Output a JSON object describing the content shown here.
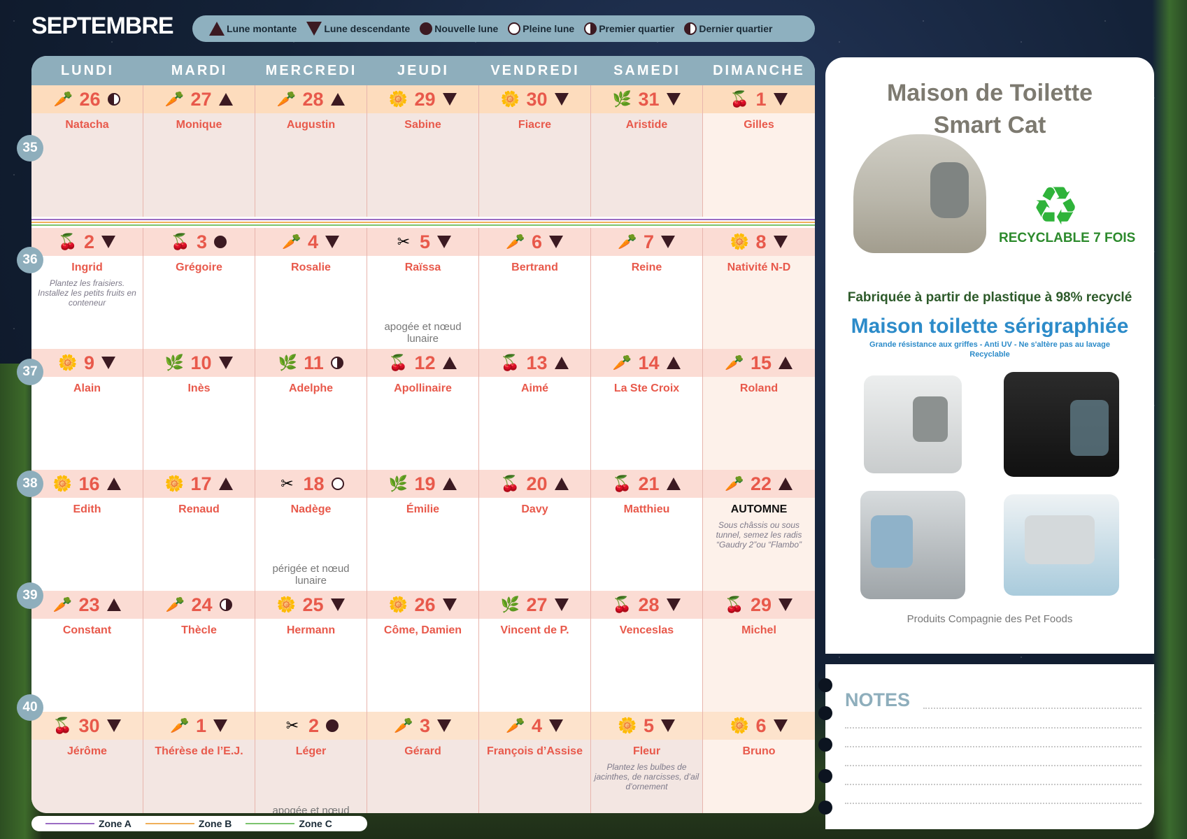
{
  "month": "SEPTEMBRE",
  "legend": {
    "rising": "Lune montante",
    "falling": "Lune descendante",
    "new_moon": "Nouvelle lune",
    "full_moon": "Pleine lune",
    "first_quarter": "Premier quartier",
    "last_quarter": "Dernier quartier"
  },
  "days": [
    "LUNDI",
    "MARDI",
    "MERCREDI",
    "JEUDI",
    "VENDREDI",
    "SAMEDI",
    "DIMANCHE"
  ],
  "weeks": [
    {
      "num": "35",
      "cells": [
        {
          "day": "26",
          "saint": "Natacha",
          "moon": "last",
          "plant": "carrot-icon",
          "glyph": "🥕"
        },
        {
          "day": "27",
          "saint": "Monique",
          "moon": "up",
          "plant": "carrot-icon",
          "glyph": "🥕"
        },
        {
          "day": "28",
          "saint": "Augustin",
          "moon": "up",
          "plant": "carrot-icon",
          "glyph": "🥕"
        },
        {
          "day": "29",
          "saint": "Sabine",
          "moon": "down",
          "plant": "flower-icon",
          "glyph": "🌼"
        },
        {
          "day": "30",
          "saint": "Fiacre",
          "moon": "down",
          "plant": "flower-icon",
          "glyph": "🌼"
        },
        {
          "day": "31",
          "saint": "Aristide",
          "moon": "down",
          "plant": "leaf-icon",
          "glyph": "🌿"
        },
        {
          "day": "1",
          "saint": "Gilles",
          "moon": "down",
          "plant": "cherry-icon",
          "glyph": "🍒"
        }
      ]
    },
    {
      "num": "36",
      "cells": [
        {
          "day": "2",
          "saint": "Ingrid",
          "moon": "down",
          "plant": "cherry-icon",
          "glyph": "🍒",
          "note": "Plantez les fraisiers. Installez les petits fruits en conteneur"
        },
        {
          "day": "3",
          "saint": "Grégoire",
          "moon": "new",
          "plant": "cherry-icon",
          "glyph": "🍒"
        },
        {
          "day": "4",
          "saint": "Rosalie",
          "moon": "down",
          "plant": "carrot-icon",
          "glyph": "🥕"
        },
        {
          "day": "5",
          "saint": "Raïssa",
          "moon": "down",
          "plant": "tools-icon",
          "glyph": "✂",
          "astro": "apogée et nœud lunaire"
        },
        {
          "day": "6",
          "saint": "Bertrand",
          "moon": "down",
          "plant": "carrot-icon",
          "glyph": "🥕"
        },
        {
          "day": "7",
          "saint": "Reine",
          "moon": "down",
          "plant": "carrot-icon",
          "glyph": "🥕"
        },
        {
          "day": "8",
          "saint": "Nativité N-D",
          "moon": "down",
          "plant": "flower-icon",
          "glyph": "🌼"
        }
      ]
    },
    {
      "num": "37",
      "cells": [
        {
          "day": "9",
          "saint": "Alain",
          "moon": "down",
          "plant": "flower-icon",
          "glyph": "🌼"
        },
        {
          "day": "10",
          "saint": "Inès",
          "moon": "down",
          "plant": "leaf-icon",
          "glyph": "🌿"
        },
        {
          "day": "11",
          "saint": "Adelphe",
          "moon": "first",
          "plant": "leaf-icon",
          "glyph": "🌿"
        },
        {
          "day": "12",
          "saint": "Apollinaire",
          "moon": "up",
          "plant": "cherry-icon",
          "glyph": "🍒"
        },
        {
          "day": "13",
          "saint": "Aimé",
          "moon": "up",
          "plant": "cherry-icon",
          "glyph": "🍒"
        },
        {
          "day": "14",
          "saint": "La Ste Croix",
          "moon": "up",
          "plant": "carrot-icon",
          "glyph": "🥕"
        },
        {
          "day": "15",
          "saint": "Roland",
          "moon": "up",
          "plant": "carrot-icon",
          "glyph": "🥕"
        }
      ]
    },
    {
      "num": "38",
      "cells": [
        {
          "day": "16",
          "saint": "Edith",
          "moon": "up",
          "plant": "flower-icon",
          "glyph": "🌼"
        },
        {
          "day": "17",
          "saint": "Renaud",
          "moon": "up",
          "plant": "flower-icon",
          "glyph": "🌼"
        },
        {
          "day": "18",
          "saint": "Nadège",
          "moon": "full",
          "plant": "tools-icon",
          "glyph": "✂",
          "astro": "périgée et nœud lunaire"
        },
        {
          "day": "19",
          "saint": "Émilie",
          "moon": "up",
          "plant": "leaf-icon",
          "glyph": "🌿"
        },
        {
          "day": "20",
          "saint": "Davy",
          "moon": "up",
          "plant": "cherry-icon",
          "glyph": "🍒"
        },
        {
          "day": "21",
          "saint": "Matthieu",
          "moon": "up",
          "plant": "cherry-icon",
          "glyph": "🍒"
        },
        {
          "day": "22",
          "saint": "AUTOMNE",
          "moon": "up",
          "plant": "carrot-icon",
          "glyph": "🥕",
          "black": true,
          "note": "Sous châssis ou sous tunnel, semez les radis “Gaudry 2”ou “Flambo”"
        }
      ]
    },
    {
      "num": "39",
      "cells": [
        {
          "day": "23",
          "saint": "Constant",
          "moon": "up",
          "plant": "carrot-icon",
          "glyph": "🥕"
        },
        {
          "day": "24",
          "saint": "Thècle",
          "moon": "first",
          "plant": "carrot-icon",
          "glyph": "🥕"
        },
        {
          "day": "25",
          "saint": "Hermann",
          "moon": "down",
          "plant": "flower-icon",
          "glyph": "🌼"
        },
        {
          "day": "26",
          "saint": "Côme, Damien",
          "moon": "down",
          "plant": "flower-icon",
          "glyph": "🌼"
        },
        {
          "day": "27",
          "saint": "Vincent de P.",
          "moon": "down",
          "plant": "leaf-icon",
          "glyph": "🌿"
        },
        {
          "day": "28",
          "saint": "Venceslas",
          "moon": "down",
          "plant": "cherry-icon",
          "glyph": "🍒"
        },
        {
          "day": "29",
          "saint": "Michel",
          "moon": "down",
          "plant": "cherry-icon",
          "glyph": "🍒"
        }
      ]
    },
    {
      "num": "40",
      "cells": [
        {
          "day": "30",
          "saint": "Jérôme",
          "moon": "down",
          "plant": "cherry-icon",
          "glyph": "🍒"
        },
        {
          "day": "1",
          "saint": "Thérèse de l’E.J.",
          "moon": "down",
          "plant": "carrot-icon",
          "glyph": "🥕"
        },
        {
          "day": "2",
          "saint": "Léger",
          "moon": "new",
          "plant": "tools-icon",
          "glyph": "✂",
          "astro": "apogée et nœud lunaire"
        },
        {
          "day": "3",
          "saint": "Gérard",
          "moon": "down",
          "plant": "carrot-icon",
          "glyph": "🥕"
        },
        {
          "day": "4",
          "saint": "François d’Assise",
          "moon": "down",
          "plant": "carrot-icon",
          "glyph": "🥕"
        },
        {
          "day": "5",
          "saint": "Fleur",
          "moon": "down",
          "plant": "flower-icon",
          "glyph": "🌼",
          "note": "Plantez les bulbes de jacinthes, de narcisses, d’ail d’ornement"
        },
        {
          "day": "6",
          "saint": "Bruno",
          "moon": "down",
          "plant": "flower-icon",
          "glyph": "🌼"
        }
      ]
    }
  ],
  "zones": [
    {
      "label": "Zone A",
      "color": "#9b6cc4"
    },
    {
      "label": "Zone B",
      "color": "#f0b05a"
    },
    {
      "label": "Zone C",
      "color": "#7cc46e"
    }
  ],
  "ad": {
    "title_line1": "Maison de Toilette",
    "title_line2": "Smart Cat",
    "recycle_label": "RECYCLABLE 7 FOIS",
    "fabrique": "Fabriquée à partir de plastique à 98% recyclé",
    "serigraphie": "Maison toilette sérigraphiée",
    "serigraphie_sub": "Grande résistance aux griffes - Anti UV - Ne s'altère pas au lavage Recyclable",
    "footer": "Produits Compagnie des Pet Foods"
  },
  "notes_title": "NOTES",
  "colors": {
    "accent": "#8eaebc",
    "day_number": "#e8594b",
    "moon_dark": "#3c1a22"
  }
}
